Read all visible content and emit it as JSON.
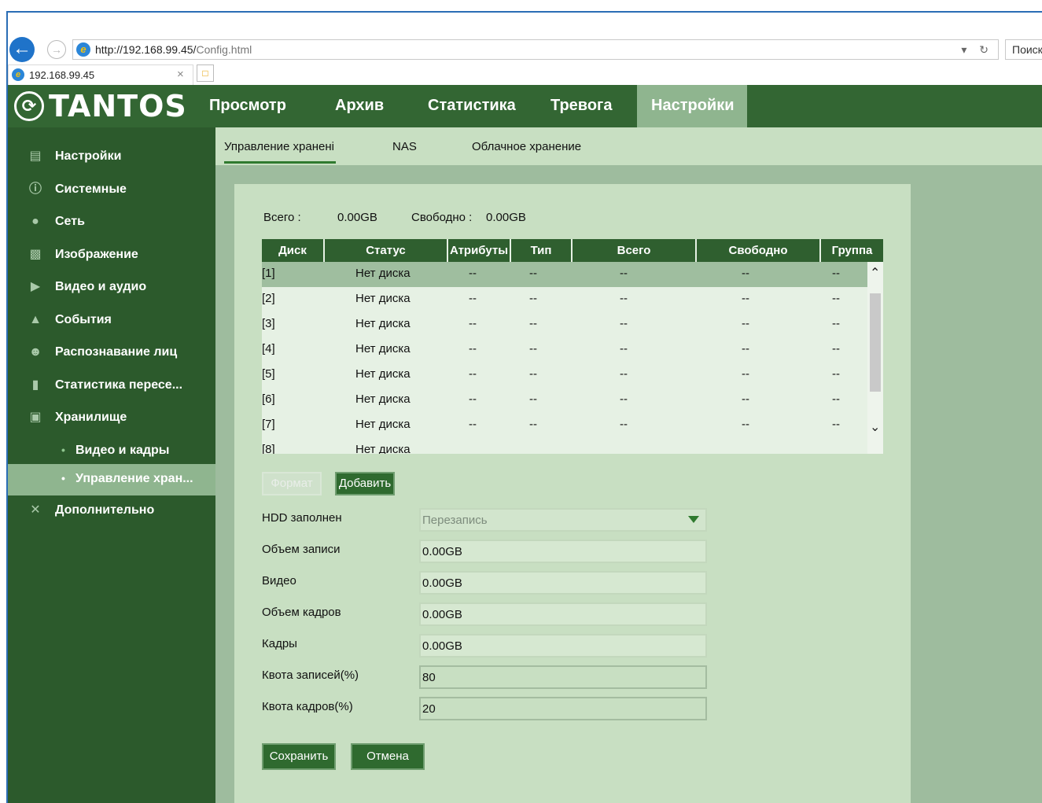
{
  "browser": {
    "url_host": "http://192.168.99.45/",
    "url_path": "Config.html",
    "url_actions": "▾ ↻",
    "search_placeholder": "Поиск",
    "tab_title": "192.168.99.45",
    "tab_close": "×"
  },
  "app": {
    "logo_text": "TANTOS",
    "nav": [
      {
        "label": "Просмотр"
      },
      {
        "label": "Архив"
      },
      {
        "label": "Статистика"
      },
      {
        "label": "Тревога"
      },
      {
        "label": "Настройки",
        "active": true
      }
    ]
  },
  "sidebar": {
    "items": [
      {
        "label": "Настройки"
      },
      {
        "label": "Системные"
      },
      {
        "label": "Сеть"
      },
      {
        "label": "Изображение"
      },
      {
        "label": "Видео и аудио"
      },
      {
        "label": "События"
      },
      {
        "label": "Распознавание лиц"
      },
      {
        "label": "Статистика пересе..."
      },
      {
        "label": "Хранилище"
      },
      {
        "label": "Видео и кадры",
        "sub": true
      },
      {
        "label": "Управление хран...",
        "sub": true,
        "active": true
      },
      {
        "label": "Дополнительно"
      }
    ]
  },
  "subtabs": [
    "Управление хранені",
    "NAS",
    "Облачное хранение"
  ],
  "summary": {
    "total_label": "Всего :",
    "total_value": "0.00GB",
    "free_label": "Свободно :",
    "free_value": "0.00GB"
  },
  "disk_table": {
    "headers": [
      "Диск",
      "Статус",
      "Атрибуты",
      "Тип",
      "Всего",
      "Свободно",
      "Группа"
    ],
    "rows": [
      [
        "[1]",
        "Нет диска",
        "--",
        "--",
        "--",
        "--",
        "--"
      ],
      [
        "[2]",
        "Нет диска",
        "--",
        "--",
        "--",
        "--",
        "--"
      ],
      [
        "[3]",
        "Нет диска",
        "--",
        "--",
        "--",
        "--",
        "--"
      ],
      [
        "[4]",
        "Нет диска",
        "--",
        "--",
        "--",
        "--",
        "--"
      ],
      [
        "[5]",
        "Нет диска",
        "--",
        "--",
        "--",
        "--",
        "--"
      ],
      [
        "[6]",
        "Нет диска",
        "--",
        "--",
        "--",
        "--",
        "--"
      ],
      [
        "[7]",
        "Нет диска",
        "--",
        "--",
        "--",
        "--",
        "--"
      ]
    ],
    "partial_row": [
      "[8]",
      "Нет диска"
    ],
    "selected_row": 0
  },
  "buttons": {
    "format": "Формат",
    "add": "Добавить",
    "save": "Сохранить",
    "cancel": "Отмена"
  },
  "form": {
    "hdd_full_label": "HDD заполнен",
    "hdd_full_value": "Перезапись",
    "record_volume_label": "Объем записи",
    "record_volume_value": "0.00GB",
    "video_label": "Видео",
    "video_value": "0.00GB",
    "frames_volume_label": "Объем кадров",
    "frames_volume_value": "0.00GB",
    "frames_label": "Кадры",
    "frames_value": "0.00GB",
    "record_quota_label": "Квота записей(%)",
    "record_quota_value": "80",
    "frames_quota_label": "Квота кадров(%)",
    "frames_quota_value": "20"
  },
  "colors": {
    "header_green": "#336633",
    "sidebar_green": "#2c5a2c",
    "active_tab": "#8fb58f",
    "panel_bg": "#c8dfc2",
    "button_green": "#2f6a2f"
  }
}
